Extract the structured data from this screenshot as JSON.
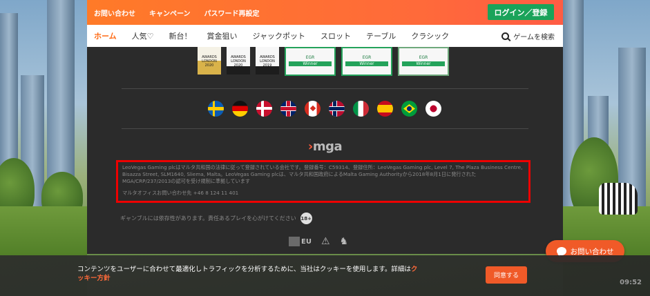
{
  "header": {
    "links": [
      "お問い合わせ",
      "キャンペーン",
      "パスワード再設定"
    ],
    "login_label": "ログイン／登録"
  },
  "nav": {
    "tabs": [
      "ホーム",
      "人気♡",
      "新台！",
      "賞金狙い",
      "ジャックポット",
      "スロット",
      "テーブル",
      "クラシック"
    ],
    "search_label": "ゲームを検索"
  },
  "awards": {
    "items": [
      {
        "text": "AWARDS LONDON 2020",
        "style": "gold"
      },
      {
        "text": "AWARDS LONDON 2020",
        "style": "dark"
      },
      {
        "text": "AWARDS LONDON 2019",
        "style": "dark"
      },
      {
        "text": "EGR",
        "sub": "Winner",
        "style": "egr"
      },
      {
        "text": "EGR",
        "sub": "Winner",
        "style": "egr"
      },
      {
        "text": "EGR",
        "sub": "Winner",
        "style": "egr-dark"
      }
    ]
  },
  "flags": [
    "se",
    "de",
    "dk",
    "gb",
    "ca",
    "no",
    "it",
    "es",
    "br",
    "jp"
  ],
  "regulator": {
    "logo_text": "mga"
  },
  "legal": {
    "text": "LeoVegas Gaming plcはマルタ共和国の法律に従って登録されている会社です。登録番号：C59314、登録住所：LeoVegas Gaming plc, Level 7, The Plaza Business Centre, Bisazza Street, SLM1640, Sliema, Malta。LeoVegas Gaming plcは、マルタ共和国政府によるMalta Gaming Authorityから2018年8月1日に発行されたMGA/CRP/237/2013の認可を受け規制に準拠しています",
    "contact": "マルタオフィスお問い合わせ先 +46 8 124 11 401"
  },
  "responsible_gambling": {
    "text": "ギャンブルには依存性があります。責任あるプレイを心がけてください",
    "age_badge": "18+"
  },
  "footer_logos": {
    "eu_label": "EU"
  },
  "cookie": {
    "text": "コンテンツをユーザーに合わせて最適化しトラフィックを分析するために、当社はクッキーを使用します。詳細は",
    "link_label": "クッキー方針",
    "agree_label": "同意する"
  },
  "chat": {
    "label": "お問い合わせ"
  },
  "clock": "09:52",
  "colors": {
    "brand_orange": "#ff6a14",
    "login_green": "#1aa35a",
    "highlight_red": "#ee0000",
    "dark_bg": "#2b2b2b"
  }
}
